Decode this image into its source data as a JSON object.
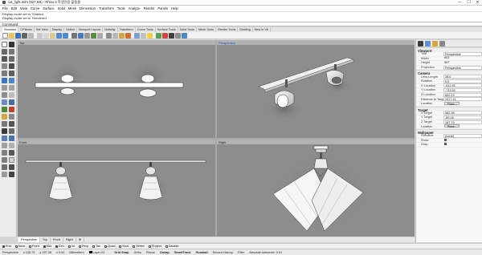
{
  "window": {
    "title": "cat_light.3dm (827 KB) - Rhino 6 학생전용 불용율",
    "minimize": "—",
    "maximize": "☐",
    "close": "✕"
  },
  "menu": [
    "File",
    "Edit",
    "View",
    "Curve",
    "Surface",
    "Solid",
    "Mesh",
    "Dimension",
    "Transform",
    "Tools",
    "Analyze",
    "Render",
    "Panels",
    "Help"
  ],
  "command_history": [
    "Display mode set to 'Shaded'",
    "Display mode set to 'Rendered'"
  ],
  "command_prompt": "Command:",
  "toolbar_tabs": [
    "Standard",
    "CPlanes",
    "Set View",
    "Display",
    "Select",
    "Viewport Layout",
    "Visibility",
    "Transform",
    "Curve Tools",
    "Surface Tools",
    "Solid Tools",
    "Mesh Tools",
    "Render Tools",
    "Drafting",
    "New in V6"
  ],
  "active_toolbar_tab": "Standard",
  "viewports": {
    "top": "Top",
    "perspective": "Perspective",
    "front": "Front",
    "right": "Right"
  },
  "viewport_tabs": [
    "Perspective",
    "Top",
    "Front",
    "Right",
    "⊕"
  ],
  "osnaps": [
    {
      "label": "End",
      "on": true
    },
    {
      "label": "Near",
      "on": false
    },
    {
      "label": "Point",
      "on": false
    },
    {
      "label": "Mid",
      "on": true
    },
    {
      "label": "Cen",
      "on": true
    },
    {
      "label": "Int",
      "on": false
    },
    {
      "label": "Perp",
      "on": false
    },
    {
      "label": "Tan",
      "on": false
    },
    {
      "label": "Quad",
      "on": false
    },
    {
      "label": "Knot",
      "on": false
    },
    {
      "label": "Vertex",
      "on": false
    },
    {
      "label": "Project",
      "on": false
    },
    {
      "label": "Disable",
      "on": false
    }
  ],
  "status": {
    "cplane": "Perspective",
    "x": "x 128.79",
    "y": "y 157.28",
    "z": "z 0.00",
    "units": "Millimeters",
    "layer": "Layer 03",
    "layer_color": "#000000",
    "grid_snap": "Grid Snap",
    "ortho": "Ortho",
    "planar": "Planar",
    "osnap": "Osnap",
    "smarttrack": "SmartTrack",
    "gumball": "Gumball",
    "record_history": "Record History",
    "filter": "Filter",
    "tolerance": "Absolute tolerance: 0.01"
  },
  "properties": {
    "viewport_header": "Viewport",
    "viewport": [
      {
        "k": "Title",
        "v": "Perspective"
      },
      {
        "k": "Width",
        "v": "603"
      },
      {
        "k": "Height",
        "v": "397"
      },
      {
        "k": "Projection",
        "v": "Perspective"
      }
    ],
    "camera_header": "Camera",
    "camera": [
      {
        "k": "Lens Length",
        "v": "35.0"
      },
      {
        "k": "Rotation",
        "v": "0.0"
      },
      {
        "k": "X Location",
        "v": "-512.91"
      },
      {
        "k": "Y Location",
        "v": "-713.92"
      },
      {
        "k": "Z Location",
        "v": "602.23"
      },
      {
        "k": "Distance to Target",
        "v": "1017.41"
      },
      {
        "k": "Location",
        "v": "Place..."
      }
    ],
    "target_header": "Target",
    "target": [
      {
        "k": "X Target",
        "v": "362.38"
      },
      {
        "k": "Y Target",
        "v": "-89.16"
      },
      {
        "k": "Z Target",
        "v": "167.79"
      },
      {
        "k": "Location",
        "v": "Place..."
      }
    ],
    "wallpaper_header": "Wallpaper",
    "wallpaper": [
      {
        "k": "Filename",
        "v": "(none)"
      },
      {
        "k": "Show",
        "v": "",
        "checked": true
      },
      {
        "k": "Gray",
        "v": "",
        "checked": true
      }
    ]
  }
}
